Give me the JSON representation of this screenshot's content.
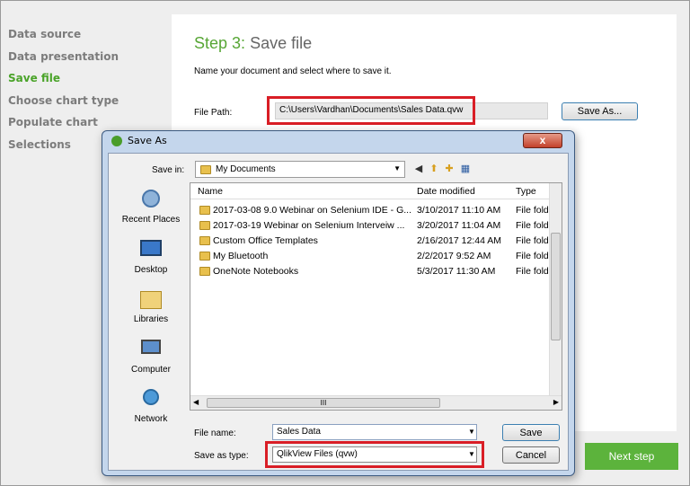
{
  "wizard": {
    "nav": [
      "Data source",
      "Data presentation",
      "Save file",
      "Choose chart type",
      "Populate chart",
      "Selections"
    ],
    "active_index": 2,
    "step_number": "Step 3:",
    "step_title": "Save file",
    "description": "Name your document and select where to save it.",
    "file_path_label": "File Path:",
    "file_path_value": "C:\\Users\\Vardhan\\Documents\\Sales Data.qvw",
    "save_as_button": "Save As...",
    "next_button": "Next step"
  },
  "dialog": {
    "title": "Save As",
    "close_glyph": "x",
    "save_in_label": "Save in:",
    "save_in_value": "My Documents",
    "places": [
      "Recent Places",
      "Desktop",
      "Libraries",
      "Computer",
      "Network"
    ],
    "columns": [
      "Name",
      "Date modified",
      "Type"
    ],
    "rows": [
      {
        "name": "2017-03-08 9.0 Webinar on Selenium IDE - G...",
        "date": "3/10/2017 11:10 AM",
        "type": "File folder"
      },
      {
        "name": "2017-03-19 Webinar on Selenium Interveiw ...",
        "date": "3/20/2017 11:04 AM",
        "type": "File folder"
      },
      {
        "name": "Custom Office Templates",
        "date": "2/16/2017 12:44 AM",
        "type": "File folder"
      },
      {
        "name": "My Bluetooth",
        "date": "2/2/2017 9:52 AM",
        "type": "File folder"
      },
      {
        "name": "OneNote Notebooks",
        "date": "5/3/2017 11:30 AM",
        "type": "File folder"
      }
    ],
    "file_name_label": "File name:",
    "file_name_value": "Sales Data",
    "save_as_type_label": "Save as type:",
    "save_as_type_value": "QlikView Files (qvw)",
    "save_button": "Save",
    "cancel_button": "Cancel",
    "hscroll_glyph": "III"
  },
  "colors": {
    "accent_green": "#57a635",
    "highlight_red": "#d91e26"
  }
}
